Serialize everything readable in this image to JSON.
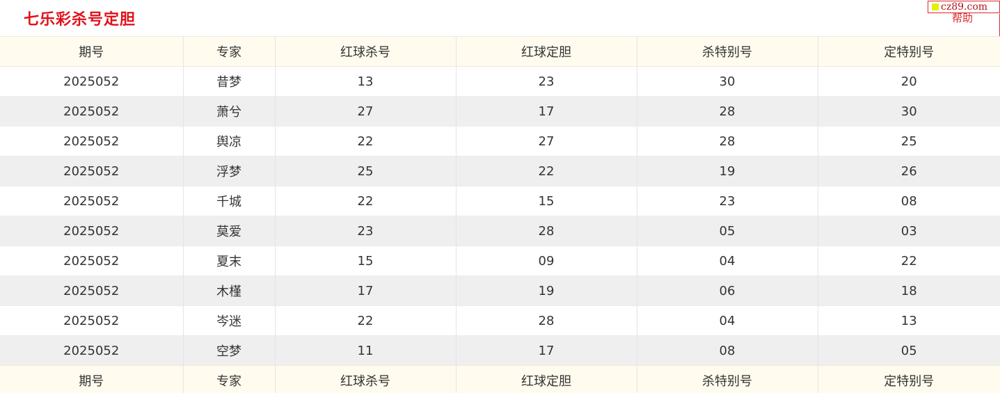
{
  "page": {
    "title": "七乐彩杀号定胆",
    "site_badge": "cz89.com",
    "help_label": "帮助"
  },
  "table": {
    "headers": [
      "期号",
      "专家",
      "红球杀号",
      "红球定胆",
      "杀特别号",
      "定特别号"
    ],
    "rows": [
      [
        "2025052",
        "昔梦",
        "13",
        "23",
        "30",
        "20"
      ],
      [
        "2025052",
        "萧兮",
        "27",
        "17",
        "28",
        "30"
      ],
      [
        "2025052",
        "舆凉",
        "22",
        "27",
        "28",
        "25"
      ],
      [
        "2025052",
        "浮梦",
        "25",
        "22",
        "19",
        "26"
      ],
      [
        "2025052",
        "千城",
        "22",
        "15",
        "23",
        "08"
      ],
      [
        "2025052",
        "莫爱",
        "23",
        "28",
        "05",
        "03"
      ],
      [
        "2025052",
        "夏末",
        "15",
        "09",
        "04",
        "22"
      ],
      [
        "2025052",
        "木槿",
        "17",
        "19",
        "06",
        "18"
      ],
      [
        "2025052",
        "岑迷",
        "22",
        "28",
        "04",
        "13"
      ],
      [
        "2025052",
        "空梦",
        "11",
        "17",
        "08",
        "05"
      ]
    ]
  },
  "colors": {
    "title": "#e0121a",
    "header_bg": "#fffbee",
    "row_alt_bg": "#efefef",
    "text": "#333333"
  }
}
